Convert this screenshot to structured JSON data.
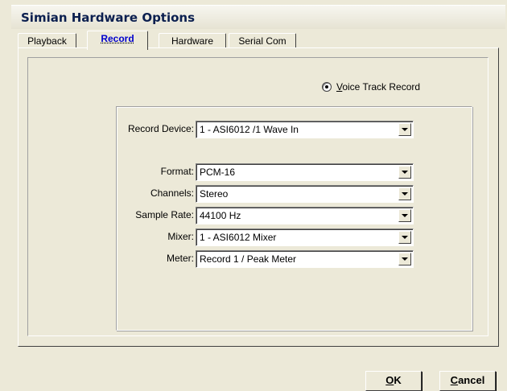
{
  "window": {
    "title": "Simian Hardware Options"
  },
  "tabs": [
    {
      "label": "Playback",
      "active": false
    },
    {
      "label": "Record",
      "active": true
    },
    {
      "label": "Hardware",
      "active": false
    },
    {
      "label": "Serial Com",
      "active": false
    }
  ],
  "record": {
    "voice_track": {
      "label_prefix": "V",
      "label_rest": "oice Track Record",
      "selected": true
    },
    "fields": {
      "device": {
        "label": "Record Device:",
        "value": "1 - ASI6012 /1 Wave In"
      },
      "format": {
        "label": "Format:",
        "value": "PCM-16"
      },
      "channels": {
        "label": "Channels:",
        "value": "Stereo"
      },
      "sample_rate": {
        "label": "Sample Rate:",
        "value": "44100 Hz"
      },
      "mixer": {
        "label": "Mixer:",
        "value": "1 - ASI6012 Mixer"
      },
      "meter": {
        "label": "Meter:",
        "value": "Record 1 / Peak Meter"
      }
    }
  },
  "buttons": {
    "ok": {
      "accel": "O",
      "rest": "K"
    },
    "cancel": {
      "accel": "C",
      "rest": "ancel"
    }
  },
  "icons": {
    "dropdown": "chevron-down-icon",
    "radio": "radio-selected-icon"
  }
}
